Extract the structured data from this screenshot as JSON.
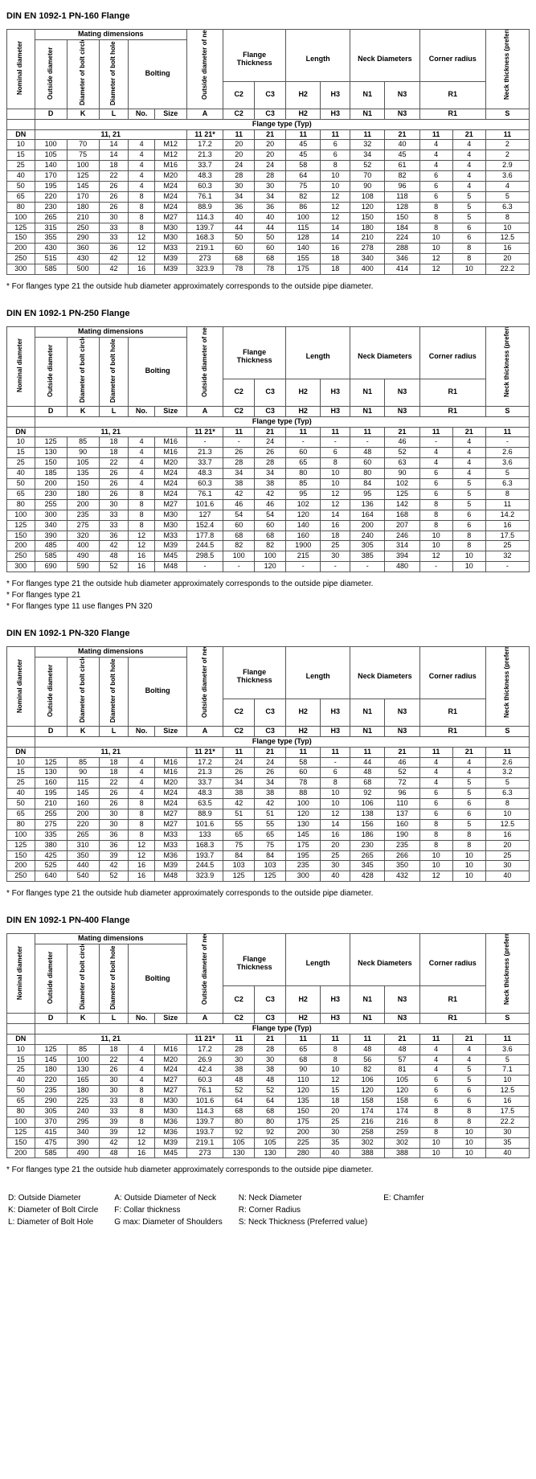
{
  "tables": [
    {
      "title": "DIN EN 1092-1 PN-160 Flange",
      "notes": [
        "* For flanges type 21 the outside hub diameter approximately corresponds to the outside pipe diameter."
      ],
      "rows": [
        [
          "10",
          "100",
          "70",
          "14",
          "4",
          "M12",
          "17.2",
          "20",
          "20",
          "45",
          "6",
          "32",
          "40",
          "4",
          "4",
          "2"
        ],
        [
          "15",
          "105",
          "75",
          "14",
          "4",
          "M12",
          "21.3",
          "20",
          "20",
          "45",
          "6",
          "34",
          "45",
          "4",
          "4",
          "2"
        ],
        [
          "25",
          "140",
          "100",
          "18",
          "4",
          "M16",
          "33.7",
          "24",
          "24",
          "58",
          "8",
          "52",
          "61",
          "4",
          "4",
          "2.9"
        ],
        [
          "40",
          "170",
          "125",
          "22",
          "4",
          "M20",
          "48.3",
          "28",
          "28",
          "64",
          "10",
          "70",
          "82",
          "6",
          "4",
          "3.6"
        ],
        [
          "50",
          "195",
          "145",
          "26",
          "4",
          "M24",
          "60.3",
          "30",
          "30",
          "75",
          "10",
          "90",
          "96",
          "6",
          "4",
          "4"
        ],
        [
          "65",
          "220",
          "170",
          "26",
          "8",
          "M24",
          "76.1",
          "34",
          "34",
          "82",
          "12",
          "108",
          "118",
          "6",
          "5",
          "5"
        ],
        [
          "80",
          "230",
          "180",
          "26",
          "8",
          "M24",
          "88.9",
          "36",
          "36",
          "86",
          "12",
          "120",
          "128",
          "8",
          "5",
          "6.3"
        ],
        [
          "100",
          "265",
          "210",
          "30",
          "8",
          "M27",
          "114.3",
          "40",
          "40",
          "100",
          "12",
          "150",
          "150",
          "8",
          "5",
          "8"
        ],
        [
          "125",
          "315",
          "250",
          "33",
          "8",
          "M30",
          "139.7",
          "44",
          "44",
          "115",
          "14",
          "180",
          "184",
          "8",
          "6",
          "10"
        ],
        [
          "150",
          "355",
          "290",
          "33",
          "12",
          "M30",
          "168.3",
          "50",
          "50",
          "128",
          "14",
          "210",
          "224",
          "10",
          "6",
          "12.5"
        ],
        [
          "200",
          "430",
          "360",
          "36",
          "12",
          "M33",
          "219.1",
          "60",
          "60",
          "140",
          "16",
          "278",
          "288",
          "10",
          "8",
          "16"
        ],
        [
          "250",
          "515",
          "430",
          "42",
          "12",
          "M39",
          "273",
          "68",
          "68",
          "155",
          "18",
          "340",
          "346",
          "12",
          "8",
          "20"
        ],
        [
          "300",
          "585",
          "500",
          "42",
          "16",
          "M39",
          "323.9",
          "78",
          "78",
          "175",
          "18",
          "400",
          "414",
          "12",
          "10",
          "22.2"
        ]
      ]
    },
    {
      "title": "DIN EN 1092-1 PN-250 Flange",
      "notes": [
        "* For flanges type 21 the outside hub diameter approximately corresponds to the outside pipe diameter.",
        "* For flanges type 21",
        "* For flanges type 11 use flanges PN 320"
      ],
      "rows": [
        [
          "10",
          "125",
          "85",
          "18",
          "4",
          "M16",
          "-",
          "-",
          "24",
          "-",
          "-",
          "-",
          "46",
          "-",
          "4",
          "-"
        ],
        [
          "15",
          "130",
          "90",
          "18",
          "4",
          "M16",
          "21.3",
          "26",
          "26",
          "60",
          "6",
          "48",
          "52",
          "4",
          "4",
          "2.6"
        ],
        [
          "25",
          "150",
          "105",
          "22",
          "4",
          "M20",
          "33.7",
          "28",
          "28",
          "65",
          "8",
          "60",
          "63",
          "4",
          "4",
          "3.6"
        ],
        [
          "40",
          "185",
          "135",
          "26",
          "4",
          "M24",
          "48.3",
          "34",
          "34",
          "80",
          "10",
          "80",
          "90",
          "6",
          "4",
          "5"
        ],
        [
          "50",
          "200",
          "150",
          "26",
          "4",
          "M24",
          "60.3",
          "38",
          "38",
          "85",
          "10",
          "84",
          "102",
          "6",
          "5",
          "6.3"
        ],
        [
          "65",
          "230",
          "180",
          "26",
          "8",
          "M24",
          "76.1",
          "42",
          "42",
          "95",
          "12",
          "95",
          "125",
          "6",
          "5",
          "8"
        ],
        [
          "80",
          "255",
          "200",
          "30",
          "8",
          "M27",
          "101.6",
          "46",
          "46",
          "102",
          "12",
          "136",
          "142",
          "8",
          "5",
          "11"
        ],
        [
          "100",
          "300",
          "235",
          "33",
          "8",
          "M30",
          "127",
          "54",
          "54",
          "120",
          "14",
          "164",
          "168",
          "8",
          "6",
          "14.2"
        ],
        [
          "125",
          "340",
          "275",
          "33",
          "8",
          "M30",
          "152.4",
          "60",
          "60",
          "140",
          "16",
          "200",
          "207",
          "8",
          "6",
          "16"
        ],
        [
          "150",
          "390",
          "320",
          "36",
          "12",
          "M33",
          "177.8",
          "68",
          "68",
          "160",
          "18",
          "240",
          "246",
          "10",
          "8",
          "17.5"
        ],
        [
          "200",
          "485",
          "400",
          "42",
          "12",
          "M39",
          "244.5",
          "82",
          "82",
          "1900",
          "25",
          "305",
          "314",
          "10",
          "8",
          "25"
        ],
        [
          "250",
          "585",
          "490",
          "48",
          "16",
          "M45",
          "298.5",
          "100",
          "100",
          "215",
          "30",
          "385",
          "394",
          "12",
          "10",
          "32"
        ],
        [
          "300",
          "690",
          "590",
          "52",
          "16",
          "M48",
          "-",
          "-",
          "120",
          "-",
          "-",
          "-",
          "480",
          "-",
          "10",
          "-"
        ]
      ]
    },
    {
      "title": "DIN EN 1092-1 PN-320 Flange",
      "notes": [
        "* For flanges type 21 the outside hub diameter approximately corresponds to the outside pipe diameter."
      ],
      "rows": [
        [
          "10",
          "125",
          "85",
          "18",
          "4",
          "M16",
          "17.2",
          "24",
          "24",
          "58",
          "-",
          "44",
          "46",
          "4",
          "4",
          "2.6"
        ],
        [
          "15",
          "130",
          "90",
          "18",
          "4",
          "M16",
          "21.3",
          "26",
          "26",
          "60",
          "6",
          "48",
          "52",
          "4",
          "4",
          "3.2"
        ],
        [
          "25",
          "160",
          "115",
          "22",
          "4",
          "M20",
          "33.7",
          "34",
          "34",
          "78",
          "8",
          "68",
          "72",
          "4",
          "5",
          "5"
        ],
        [
          "40",
          "195",
          "145",
          "26",
          "4",
          "M24",
          "48.3",
          "38",
          "38",
          "88",
          "10",
          "92",
          "96",
          "6",
          "5",
          "6.3"
        ],
        [
          "50",
          "210",
          "160",
          "26",
          "8",
          "M24",
          "63.5",
          "42",
          "42",
          "100",
          "10",
          "106",
          "110",
          "6",
          "6",
          "8"
        ],
        [
          "65",
          "255",
          "200",
          "30",
          "8",
          "M27",
          "88.9",
          "51",
          "51",
          "120",
          "12",
          "138",
          "137",
          "6",
          "6",
          "10"
        ],
        [
          "80",
          "275",
          "220",
          "30",
          "8",
          "M27",
          "101.6",
          "55",
          "55",
          "130",
          "14",
          "156",
          "160",
          "8",
          "5",
          "12.5"
        ],
        [
          "100",
          "335",
          "265",
          "36",
          "8",
          "M33",
          "133",
          "65",
          "65",
          "145",
          "16",
          "186",
          "190",
          "8",
          "8",
          "16"
        ],
        [
          "125",
          "380",
          "310",
          "36",
          "12",
          "M33",
          "168.3",
          "75",
          "75",
          "175",
          "20",
          "230",
          "235",
          "8",
          "8",
          "20"
        ],
        [
          "150",
          "425",
          "350",
          "39",
          "12",
          "M36",
          "193.7",
          "84",
          "84",
          "195",
          "25",
          "265",
          "266",
          "10",
          "10",
          "25"
        ],
        [
          "200",
          "525",
          "440",
          "42",
          "16",
          "M39",
          "244.5",
          "103",
          "103",
          "235",
          "30",
          "345",
          "350",
          "10",
          "10",
          "30"
        ],
        [
          "250",
          "640",
          "540",
          "52",
          "16",
          "M48",
          "323.9",
          "125",
          "125",
          "300",
          "40",
          "428",
          "432",
          "12",
          "10",
          "40"
        ]
      ]
    },
    {
      "title": "DIN EN 1092-1 PN-400 Flange",
      "notes": [
        "* For flanges type 21 the outside hub diameter approximately corresponds to the outside pipe diameter."
      ],
      "rows": [
        [
          "10",
          "125",
          "85",
          "18",
          "4",
          "M16",
          "17.2",
          "28",
          "28",
          "65",
          "8",
          "48",
          "48",
          "4",
          "4",
          "3.6"
        ],
        [
          "15",
          "145",
          "100",
          "22",
          "4",
          "M20",
          "26.9",
          "30",
          "30",
          "68",
          "8",
          "56",
          "57",
          "4",
          "4",
          "5"
        ],
        [
          "25",
          "180",
          "130",
          "26",
          "4",
          "M24",
          "42.4",
          "38",
          "38",
          "90",
          "10",
          "82",
          "81",
          "4",
          "5",
          "7.1"
        ],
        [
          "40",
          "220",
          "165",
          "30",
          "4",
          "M27",
          "60.3",
          "48",
          "48",
          "110",
          "12",
          "106",
          "105",
          "6",
          "5",
          "10"
        ],
        [
          "50",
          "235",
          "180",
          "30",
          "8",
          "M27",
          "76.1",
          "52",
          "52",
          "120",
          "15",
          "120",
          "120",
          "6",
          "6",
          "12.5"
        ],
        [
          "65",
          "290",
          "225",
          "33",
          "8",
          "M30",
          "101.6",
          "64",
          "64",
          "135",
          "18",
          "158",
          "158",
          "6",
          "6",
          "16"
        ],
        [
          "80",
          "305",
          "240",
          "33",
          "8",
          "M30",
          "114.3",
          "68",
          "68",
          "150",
          "20",
          "174",
          "174",
          "8",
          "8",
          "17.5"
        ],
        [
          "100",
          "370",
          "295",
          "39",
          "8",
          "M36",
          "139.7",
          "80",
          "80",
          "175",
          "25",
          "216",
          "216",
          "8",
          "8",
          "22.2"
        ],
        [
          "125",
          "415",
          "340",
          "39",
          "12",
          "M36",
          "193.7",
          "92",
          "92",
          "200",
          "30",
          "258",
          "259",
          "8",
          "10",
          "30"
        ],
        [
          "150",
          "475",
          "390",
          "42",
          "12",
          "M39",
          "219.1",
          "105",
          "105",
          "225",
          "35",
          "302",
          "302",
          "10",
          "10",
          "35"
        ],
        [
          "200",
          "585",
          "490",
          "48",
          "16",
          "M45",
          "273",
          "130",
          "130",
          "280",
          "40",
          "388",
          "388",
          "10",
          "10",
          "40"
        ]
      ]
    }
  ],
  "headers": {
    "mating": "Mating dimensions",
    "nom": "Nominal diameter",
    "od": "Outside diameter",
    "dbc": "Diameter of bolt circle",
    "dbh": "Diameter of bolt hole",
    "bolting": "Bolting",
    "odn": "Outside diameter of neck",
    "ft": "Flange Thickness",
    "len": "Length",
    "nd": "Neck Diameters",
    "cr": "Corner radius",
    "nt": "Neck thickness (preferred values)",
    "row_sym": [
      "D",
      "K",
      "L",
      "No.",
      "Size",
      "A",
      "C2",
      "C3",
      "H2",
      "H3",
      "N1",
      "N3",
      "R1",
      "",
      "S"
    ],
    "typ": "Flange type (Typ)",
    "dn": "DN",
    "g1": "11, 21",
    "g2": "11 21*",
    "types_row": [
      "11",
      "21",
      "11",
      "11",
      "11",
      "21",
      "11",
      "21",
      "11"
    ]
  },
  "legend": [
    [
      "D: Outside Diameter",
      "A: Outside Diameter of Neck",
      "N: Neck Diameter",
      "E: Chamfer"
    ],
    [
      "K: Diameter of Bolt Circle",
      "F: Collar thickness",
      "R: Corner Radius",
      ""
    ],
    [
      "L: Diameter of Bolt Hole",
      "G max: Diameter of Shoulders",
      "S: Neck Thickness (Preferred value)",
      ""
    ]
  ]
}
